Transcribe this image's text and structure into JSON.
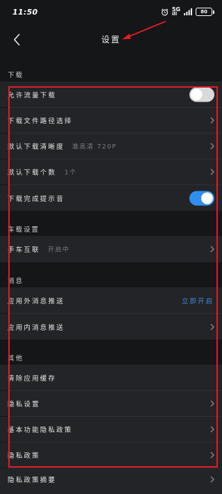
{
  "status_bar": {
    "time": "11:50",
    "network": "5G",
    "network_sub": "ill",
    "battery": "80"
  },
  "header": {
    "title": "设置"
  },
  "sections": {
    "download": {
      "label": "下载",
      "rows": {
        "allow_mobile_data": {
          "label": "允许流量下载",
          "toggle": "off"
        },
        "path": {
          "label": "下载文件路径选择"
        },
        "quality": {
          "label": "默认下载清晰度",
          "value": "准高清 720P"
        },
        "count": {
          "label": "默认下载个数",
          "value": "1个"
        },
        "complete_tip": {
          "label": "下载完成提示音",
          "toggle": "on"
        }
      }
    },
    "car": {
      "label": "车载设置",
      "rows": {
        "link": {
          "label": "手车互联",
          "value": "开启中"
        }
      }
    },
    "message": {
      "label": "消息",
      "rows": {
        "outside_push": {
          "label": "应用外消息推送",
          "link": "立即开启"
        },
        "inside_push": {
          "label": "应用内消息推送"
        }
      }
    },
    "other": {
      "label": "其他",
      "rows": {
        "clear_cache": {
          "label": "清除应用缓存"
        },
        "privacy_settings": {
          "label": "隐私设置"
        },
        "basic_privacy_policy": {
          "label": "基本功能隐私政策"
        },
        "privacy_policy": {
          "label": "隐私政策"
        },
        "privacy_summary": {
          "label": "隐私政策摘要"
        }
      }
    }
  },
  "colors": {
    "background": "#151618",
    "row_background": "#232427",
    "accent_blue": "#2f8ff0",
    "link_blue": "#3e8ed8",
    "annotation_red": "#e01d24"
  }
}
